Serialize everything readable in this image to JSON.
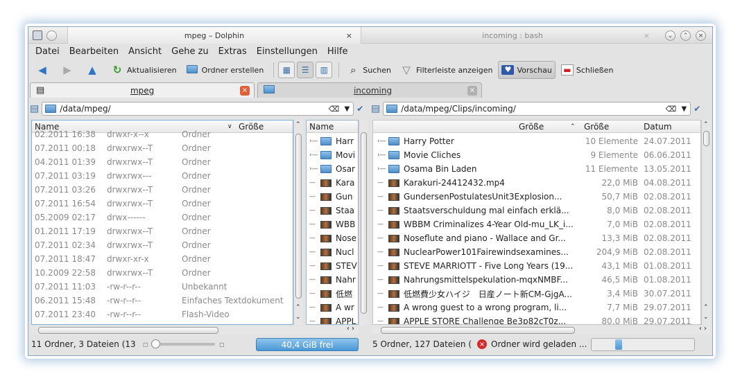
{
  "window": {
    "active_tab_title": "mpeg – Dolphin",
    "inactive_tab_title": "incoming : bash",
    "close_glyph": "×"
  },
  "menu": [
    "Datei",
    "Bearbeiten",
    "Ansicht",
    "Gehe zu",
    "Extras",
    "Einstellungen",
    "Hilfe"
  ],
  "toolbar": {
    "reload": "Aktualisieren",
    "new_folder": "Ordner erstellen",
    "search": "Suchen",
    "filter": "Filterleiste anzeigen",
    "preview": "Vorschau",
    "close": "Schließen"
  },
  "tabs": [
    {
      "label": "mpeg",
      "close_color": "#e0603a"
    },
    {
      "label": "incoming",
      "close_color": "#b0b0b0"
    }
  ],
  "left": {
    "path": "/data/mpeg/",
    "col_name": "Name",
    "col_size": "Größe",
    "rows": [
      {
        "date": "02.2011 16:38",
        "perm": "drwxr-x--x",
        "type": "Ordner"
      },
      {
        "date": "07.2011 00:18",
        "perm": "drwxrwx--T",
        "type": "Ordner"
      },
      {
        "date": "04.2011 01:39",
        "perm": "drwxrwx--T",
        "type": "Ordner"
      },
      {
        "date": "07.2011 03:19",
        "perm": "drwxrwx---",
        "type": "Ordner"
      },
      {
        "date": "07.2011 03:26",
        "perm": "drwxrwx--T",
        "type": "Ordner"
      },
      {
        "date": "07.2011 16:54",
        "perm": "drwxrwx--T",
        "type": "Ordner"
      },
      {
        "date": "05.2009 02:17",
        "perm": "drwx------",
        "type": "Ordner"
      },
      {
        "date": "01.2011 17:19",
        "perm": "drwxrwx--T",
        "type": "Ordner"
      },
      {
        "date": "07.2011 02:34",
        "perm": "drwxrwx--T",
        "type": "Ordner"
      },
      {
        "date": "07.2011 18:47",
        "perm": "drwxr-xr-x",
        "type": "Ordner"
      },
      {
        "date": "10.2009 22:58",
        "perm": "drwxrwx--T",
        "type": "Ordner"
      },
      {
        "date": "07.2011 11:03",
        "perm": "-rw-r--r--",
        "type": "Unbekannt"
      },
      {
        "date": "06.2011 15:48",
        "perm": "-rw-r--r--",
        "type": "Einfaches Textdokument"
      },
      {
        "date": "07.2011 23:40",
        "perm": "-rw-r--r--",
        "type": "Flash-Video"
      }
    ],
    "status": "11 Ordner, 3 Dateien (13",
    "free": "40,4 GiB frei"
  },
  "middle": {
    "col_name": "Name",
    "items": [
      "Harr",
      "Movi",
      "Osar",
      "Kara",
      "Gun",
      "Staa",
      "WBB",
      "Nose",
      "Nucl",
      "STEV",
      "Nahr",
      "低燃",
      "A wr",
      "APPL"
    ]
  },
  "right": {
    "path": "/data/mpeg/Clips/incoming/",
    "col_size": "Größe",
    "col_size2": "Größe",
    "col_date": "Datum",
    "rows": [
      {
        "name": "Harry Potter",
        "size": "10 Elemente",
        "date": "24.07.2011",
        "kind": "folder"
      },
      {
        "name": "Movie Cliches",
        "size": "9 Elemente",
        "date": "06.06.2011",
        "kind": "folder"
      },
      {
        "name": "Osama Bin Laden",
        "size": "11 Elemente",
        "date": "13.05.2011",
        "kind": "folder"
      },
      {
        "name": "Karakuri-24412432.mp4",
        "size": "22,0 MiB",
        "date": "04.08.2011",
        "kind": "file"
      },
      {
        "name": "GundersenPostulatesUnit3Explosion...",
        "size": "50,7 MiB",
        "date": "02.08.2011",
        "kind": "file"
      },
      {
        "name": "Staatsverschuldung mal einfach erklä...",
        "size": "8,0 MiB",
        "date": "02.08.2011",
        "kind": "file"
      },
      {
        "name": "WBBM Criminalizes 4-Year Old-mu_LK_i...",
        "size": "7,0 MiB",
        "date": "02.08.2011",
        "kind": "file"
      },
      {
        "name": "Noseflute and piano - Wallace and Gr...",
        "size": "13,3 MiB",
        "date": "02.08.2011",
        "kind": "file"
      },
      {
        "name": "NuclearPower101Fairewindsexamines...",
        "size": "204,9 MiB",
        "date": "02.08.2011",
        "kind": "file"
      },
      {
        "name": "STEVE MARRIOTT - Five Long Years (19...",
        "size": "43,1 MiB",
        "date": "01.08.2011",
        "kind": "file"
      },
      {
        "name": "Nahrungsmittelspekulation-mqxNMBF...",
        "size": "46,5 MiB",
        "date": "01.08.2011",
        "kind": "file"
      },
      {
        "name": "低燃費少女ハイジ　日産ノート新CM-GjgA...",
        "size": "3,4 MiB",
        "date": "30.07.2011",
        "kind": "file"
      },
      {
        "name": "A wrong guest to a wrong program, li...",
        "size": "7,7 MiB",
        "date": "29.07.2011",
        "kind": "file"
      },
      {
        "name": "APPLE STORE Challenge Be3p82cT0z...",
        "size": "80,0 MiB",
        "date": "29.07.2011",
        "kind": "file"
      }
    ],
    "status": "5 Ordner, 127 Dateien (",
    "loading": "Ordner wird geladen ..."
  },
  "colors": {
    "accent": "#4a98d6",
    "selection_border": "#9cb6cf"
  }
}
